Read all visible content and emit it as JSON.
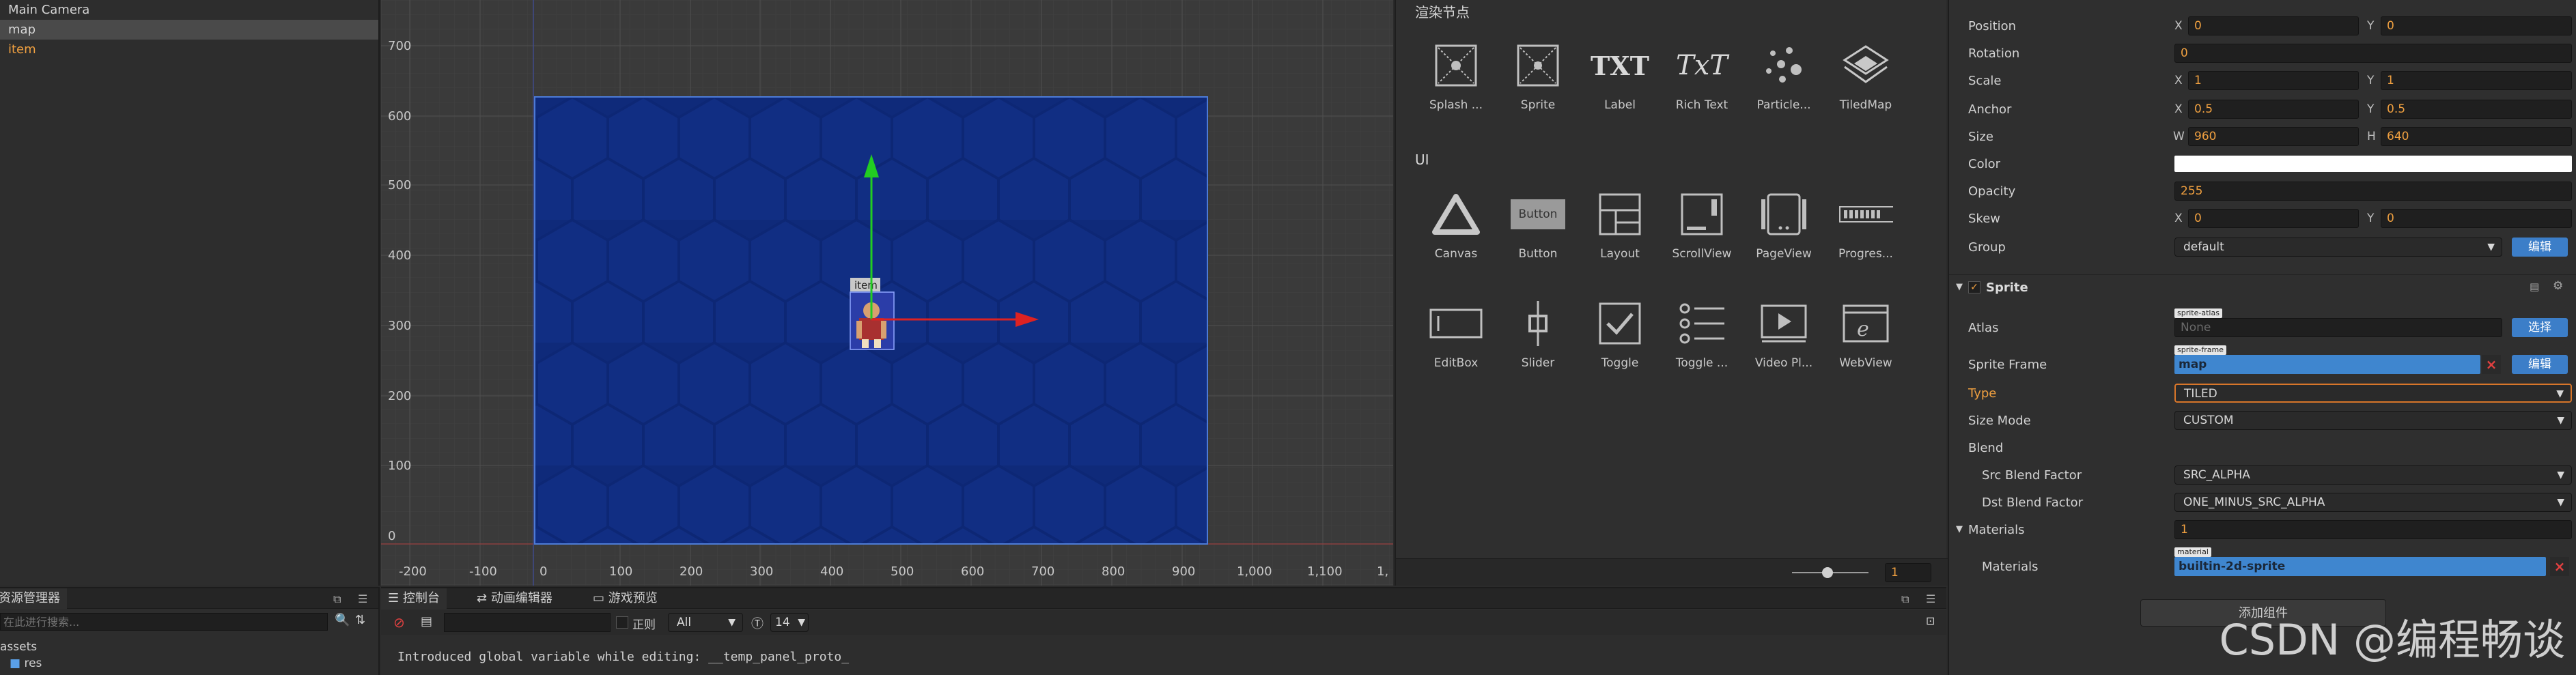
{
  "hierarchy": {
    "items": [
      {
        "label": "Main Camera"
      },
      {
        "label": "map"
      },
      {
        "label": "item"
      }
    ]
  },
  "scene": {
    "y_ticks": [
      "700",
      "600",
      "500",
      "400",
      "300",
      "200",
      "100",
      "0"
    ],
    "x_ticks": [
      "-200",
      "-100",
      "0",
      "100",
      "200",
      "300",
      "400",
      "500",
      "600",
      "700",
      "800",
      "900",
      "1,000",
      "1,100",
      "1,"
    ],
    "node_label": "item",
    "colors": {
      "map_fill": "#0f2a7a",
      "map_border": "#4d7bd6",
      "y_axis": "#22cc22",
      "x_axis": "#dd2222"
    }
  },
  "library": {
    "render_title": "渲染节点",
    "render_items": [
      {
        "label": "Splash ...",
        "icon": "splash-icon"
      },
      {
        "label": "Sprite",
        "icon": "sprite-icon"
      },
      {
        "label": "Label",
        "icon": "label-icon",
        "glyph": "TXT"
      },
      {
        "label": "Rich Text",
        "icon": "rich-text-icon",
        "glyph": "TxT"
      },
      {
        "label": "Particle...",
        "icon": "particle-icon"
      },
      {
        "label": "TiledMap",
        "icon": "tiledmap-icon"
      }
    ],
    "ui_title": "UI",
    "ui_items": [
      {
        "label": "Canvas",
        "icon": "canvas-icon"
      },
      {
        "label": "Button",
        "icon": "button-icon",
        "glyph": "Button"
      },
      {
        "label": "Layout",
        "icon": "layout-icon"
      },
      {
        "label": "ScrollView",
        "icon": "scrollview-icon"
      },
      {
        "label": "PageView",
        "icon": "pageview-icon"
      },
      {
        "label": "Progres...",
        "icon": "progress-icon"
      },
      {
        "label": "EditBox",
        "icon": "editbox-icon"
      },
      {
        "label": "Slider",
        "icon": "slider-icon"
      },
      {
        "label": "Toggle",
        "icon": "toggle-icon"
      },
      {
        "label": "Toggle ...",
        "icon": "toggle-group-icon"
      },
      {
        "label": "Video Pl...",
        "icon": "video-player-icon"
      },
      {
        "label": "WebView",
        "icon": "webview-icon"
      }
    ],
    "zoom_value": "1"
  },
  "inspector": {
    "position": {
      "label": "Position",
      "x": "0",
      "y": "0"
    },
    "rotation": {
      "label": "Rotation",
      "value": "0"
    },
    "scale": {
      "label": "Scale",
      "x": "1",
      "y": "1"
    },
    "anchor": {
      "label": "Anchor",
      "x": "0.5",
      "y": "0.5"
    },
    "size": {
      "label": "Size",
      "w": "960",
      "h": "640"
    },
    "color": {
      "label": "Color",
      "value": "#ffffff"
    },
    "opacity": {
      "label": "Opacity",
      "value": "255"
    },
    "skew": {
      "label": "Skew",
      "x": "0",
      "y": "0"
    },
    "group": {
      "label": "Group",
      "value": "default",
      "edit": "编辑"
    },
    "axis_labels": {
      "x": "X",
      "y": "Y",
      "w": "W",
      "h": "H"
    },
    "sprite": {
      "title": "Sprite",
      "atlas": {
        "label": "Atlas",
        "tag": "sprite-atlas",
        "value": "None",
        "button": "选择"
      },
      "frame": {
        "label": "Sprite Frame",
        "tag": "sprite-frame",
        "value": "map",
        "button": "编辑"
      },
      "type": {
        "label": "Type",
        "value": "TILED"
      },
      "size_mode": {
        "label": "Size Mode",
        "value": "CUSTOM"
      },
      "blend": {
        "label": "Blend"
      },
      "src_blend": {
        "label": "Src Blend Factor",
        "value": "SRC_ALPHA"
      },
      "dst_blend": {
        "label": "Dst Blend Factor",
        "value": "ONE_MINUS_SRC_ALPHA"
      }
    },
    "materials": {
      "title": "Materials",
      "count": "1",
      "tag": "material",
      "label": "Materials",
      "value": "builtin-2d-sprite"
    },
    "add_component": "添加组件"
  },
  "assets": {
    "title": "资源管理器",
    "search_placeholder": "在此进行搜索...",
    "tree": [
      {
        "label": "assets"
      },
      {
        "label": "res"
      }
    ]
  },
  "console": {
    "tabs": [
      {
        "label": "控制台"
      },
      {
        "label": "动画编辑器"
      },
      {
        "label": "游戏预览"
      }
    ],
    "regex_label": "正则",
    "filter_value": "All",
    "font_size": "14",
    "message": "Introduced global variable while editing: __temp_panel_proto_"
  },
  "watermark": "CSDN @编程畅谈"
}
